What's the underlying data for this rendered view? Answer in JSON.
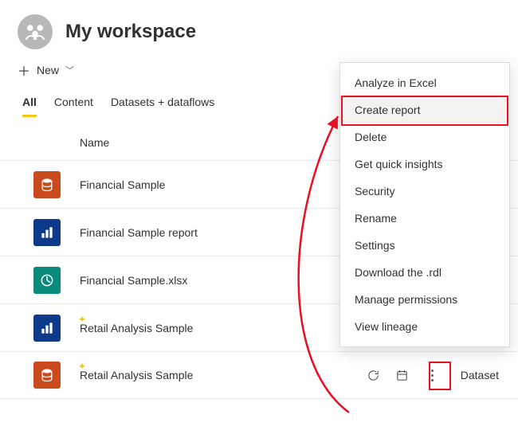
{
  "header": {
    "title": "My workspace",
    "new_button": "New"
  },
  "tabs": [
    "All",
    "Content",
    "Datasets + dataflows"
  ],
  "column_header": "Name",
  "items": [
    {
      "name": "Financial Sample",
      "tile": "orange",
      "icon": "dataset",
      "starred": false
    },
    {
      "name": "Financial Sample report",
      "tile": "blue",
      "icon": "report",
      "starred": false
    },
    {
      "name": "Financial Sample.xlsx",
      "tile": "teal",
      "icon": "workbook",
      "starred": false
    },
    {
      "name": "Retail Analysis Sample",
      "tile": "blue",
      "icon": "report",
      "starred": true
    },
    {
      "name": "Retail Analysis Sample",
      "tile": "orange",
      "icon": "dataset",
      "starred": true,
      "active": true,
      "type": "Dataset"
    }
  ],
  "context_menu": [
    "Analyze in Excel",
    "Create report",
    "Delete",
    "Get quick insights",
    "Security",
    "Rename",
    "Settings",
    "Download the .rdl",
    "Manage permissions",
    "View lineage"
  ],
  "highlighted_menu_index": 1,
  "colors": {
    "accent": "#f2c811",
    "highlight": "#e81123"
  }
}
